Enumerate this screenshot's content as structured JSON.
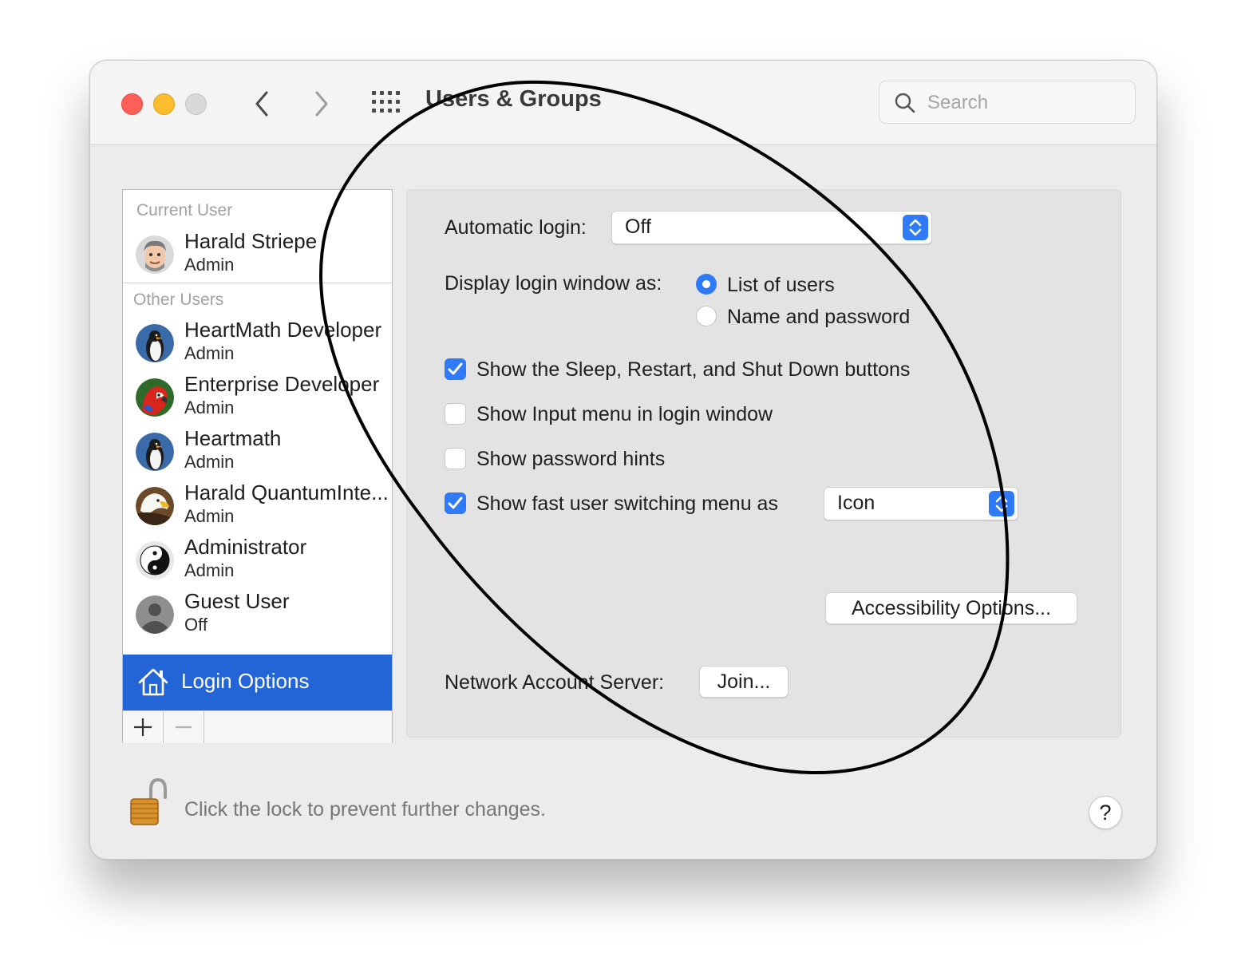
{
  "window": {
    "title": "Users & Groups"
  },
  "search": {
    "placeholder": "Search"
  },
  "sidebar": {
    "current_user_label": "Current User",
    "current_user": {
      "name": "Harald Striepe",
      "role": "Admin"
    },
    "other_users_label": "Other Users",
    "other_users": [
      {
        "name": "HeartMath Developer",
        "role": "Admin",
        "avatar": "penguin-icon"
      },
      {
        "name": "Enterprise Developer",
        "role": "Admin",
        "avatar": "parrot-icon"
      },
      {
        "name": "Heartmath",
        "role": "Admin",
        "avatar": "penguin-icon"
      },
      {
        "name": "Harald QuantumInte...",
        "role": "Admin",
        "avatar": "eagle-icon"
      },
      {
        "name": "Administrator",
        "role": "Admin",
        "avatar": "yin-yang-icon"
      },
      {
        "name": "Guest User",
        "role": "Off",
        "avatar": "generic-user-icon"
      }
    ],
    "login_options_label": "Login Options"
  },
  "panel": {
    "automatic_login_label": "Automatic login:",
    "automatic_login_value": "Off",
    "display_login_label": "Display login window as:",
    "radio_list_users": "List of users",
    "radio_name_password": "Name and password",
    "radio_selected": "List of users",
    "cb_sleep_restart": "Show the Sleep, Restart, and Shut Down buttons",
    "cb_input_menu": "Show Input menu in login window",
    "cb_password_hints": "Show password hints",
    "cb_fast_switching": "Show fast user switching menu as",
    "fast_switching_value": "Icon",
    "accessibility_button": "Accessibility Options...",
    "network_server_label": "Network Account Server:",
    "join_button": "Join..."
  },
  "checkbox_states": {
    "sleep_restart": true,
    "input_menu": false,
    "password_hints": false,
    "fast_switching": true
  },
  "footer": {
    "lock_text": "Click the lock to prevent further changes.",
    "help_label": "?"
  },
  "colors": {
    "accent": "#2f7af6",
    "selection": "#2364d6",
    "close": "#fe5f57",
    "minimize": "#febc2e",
    "zoom": "#d8d8d8"
  }
}
